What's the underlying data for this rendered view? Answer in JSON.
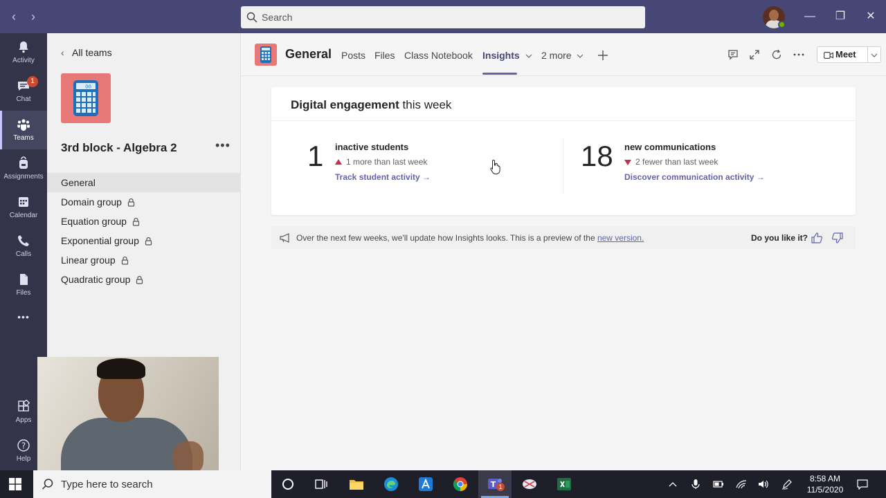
{
  "titlebar": {
    "search_placeholder": "Search"
  },
  "rail": {
    "items": [
      {
        "label": "Activity",
        "icon": "bell-icon"
      },
      {
        "label": "Chat",
        "icon": "chat-icon",
        "badge": "1"
      },
      {
        "label": "Teams",
        "icon": "teams-icon"
      },
      {
        "label": "Assignments",
        "icon": "backpack-icon"
      },
      {
        "label": "Calendar",
        "icon": "calendar-icon"
      },
      {
        "label": "Calls",
        "icon": "phone-icon"
      },
      {
        "label": "Files",
        "icon": "file-icon"
      },
      {
        "label": "Apps",
        "icon": "apps-icon"
      },
      {
        "label": "Help",
        "icon": "help-icon"
      }
    ],
    "more": "•••"
  },
  "panel": {
    "back_label": "All teams",
    "team_name": "3rd block - Algebra 2",
    "more": "•••",
    "channels": [
      {
        "label": "General",
        "locked": false
      },
      {
        "label": "Domain group",
        "locked": true
      },
      {
        "label": "Equation group",
        "locked": true
      },
      {
        "label": "Exponential group",
        "locked": true
      },
      {
        "label": "Linear group",
        "locked": true
      },
      {
        "label": "Quadratic group",
        "locked": true
      }
    ]
  },
  "header": {
    "channel_title": "General",
    "tabs": [
      "Posts",
      "Files",
      "Class Notebook",
      "Insights",
      "2 more"
    ],
    "active_tab": "Insights",
    "meet_label": "Meet"
  },
  "insights": {
    "title_bold": "Digital engagement",
    "title_rest": " this week",
    "metrics": [
      {
        "value": "1",
        "label": "inactive students",
        "change": "1 more than last week",
        "direction": "up",
        "link": "Track student activity →"
      },
      {
        "value": "18",
        "label": "new communications",
        "change": "2 fewer than last week",
        "direction": "down",
        "link": "Discover communication activity →"
      }
    ]
  },
  "banner": {
    "text": "Over the next few weeks, we'll update how Insights looks. This is a preview of the ",
    "link": "new version.",
    "question": "Do you like it?"
  },
  "taskbar": {
    "search_placeholder": "Type here to search",
    "time": "8:58 AM",
    "date": "11/5/2020",
    "teams_badge": "1"
  },
  "colors": {
    "titlebar": "#464775",
    "rail": "#33344a",
    "accent": "#6264a7",
    "tile": "#e87878",
    "alert": "#c4314b"
  }
}
